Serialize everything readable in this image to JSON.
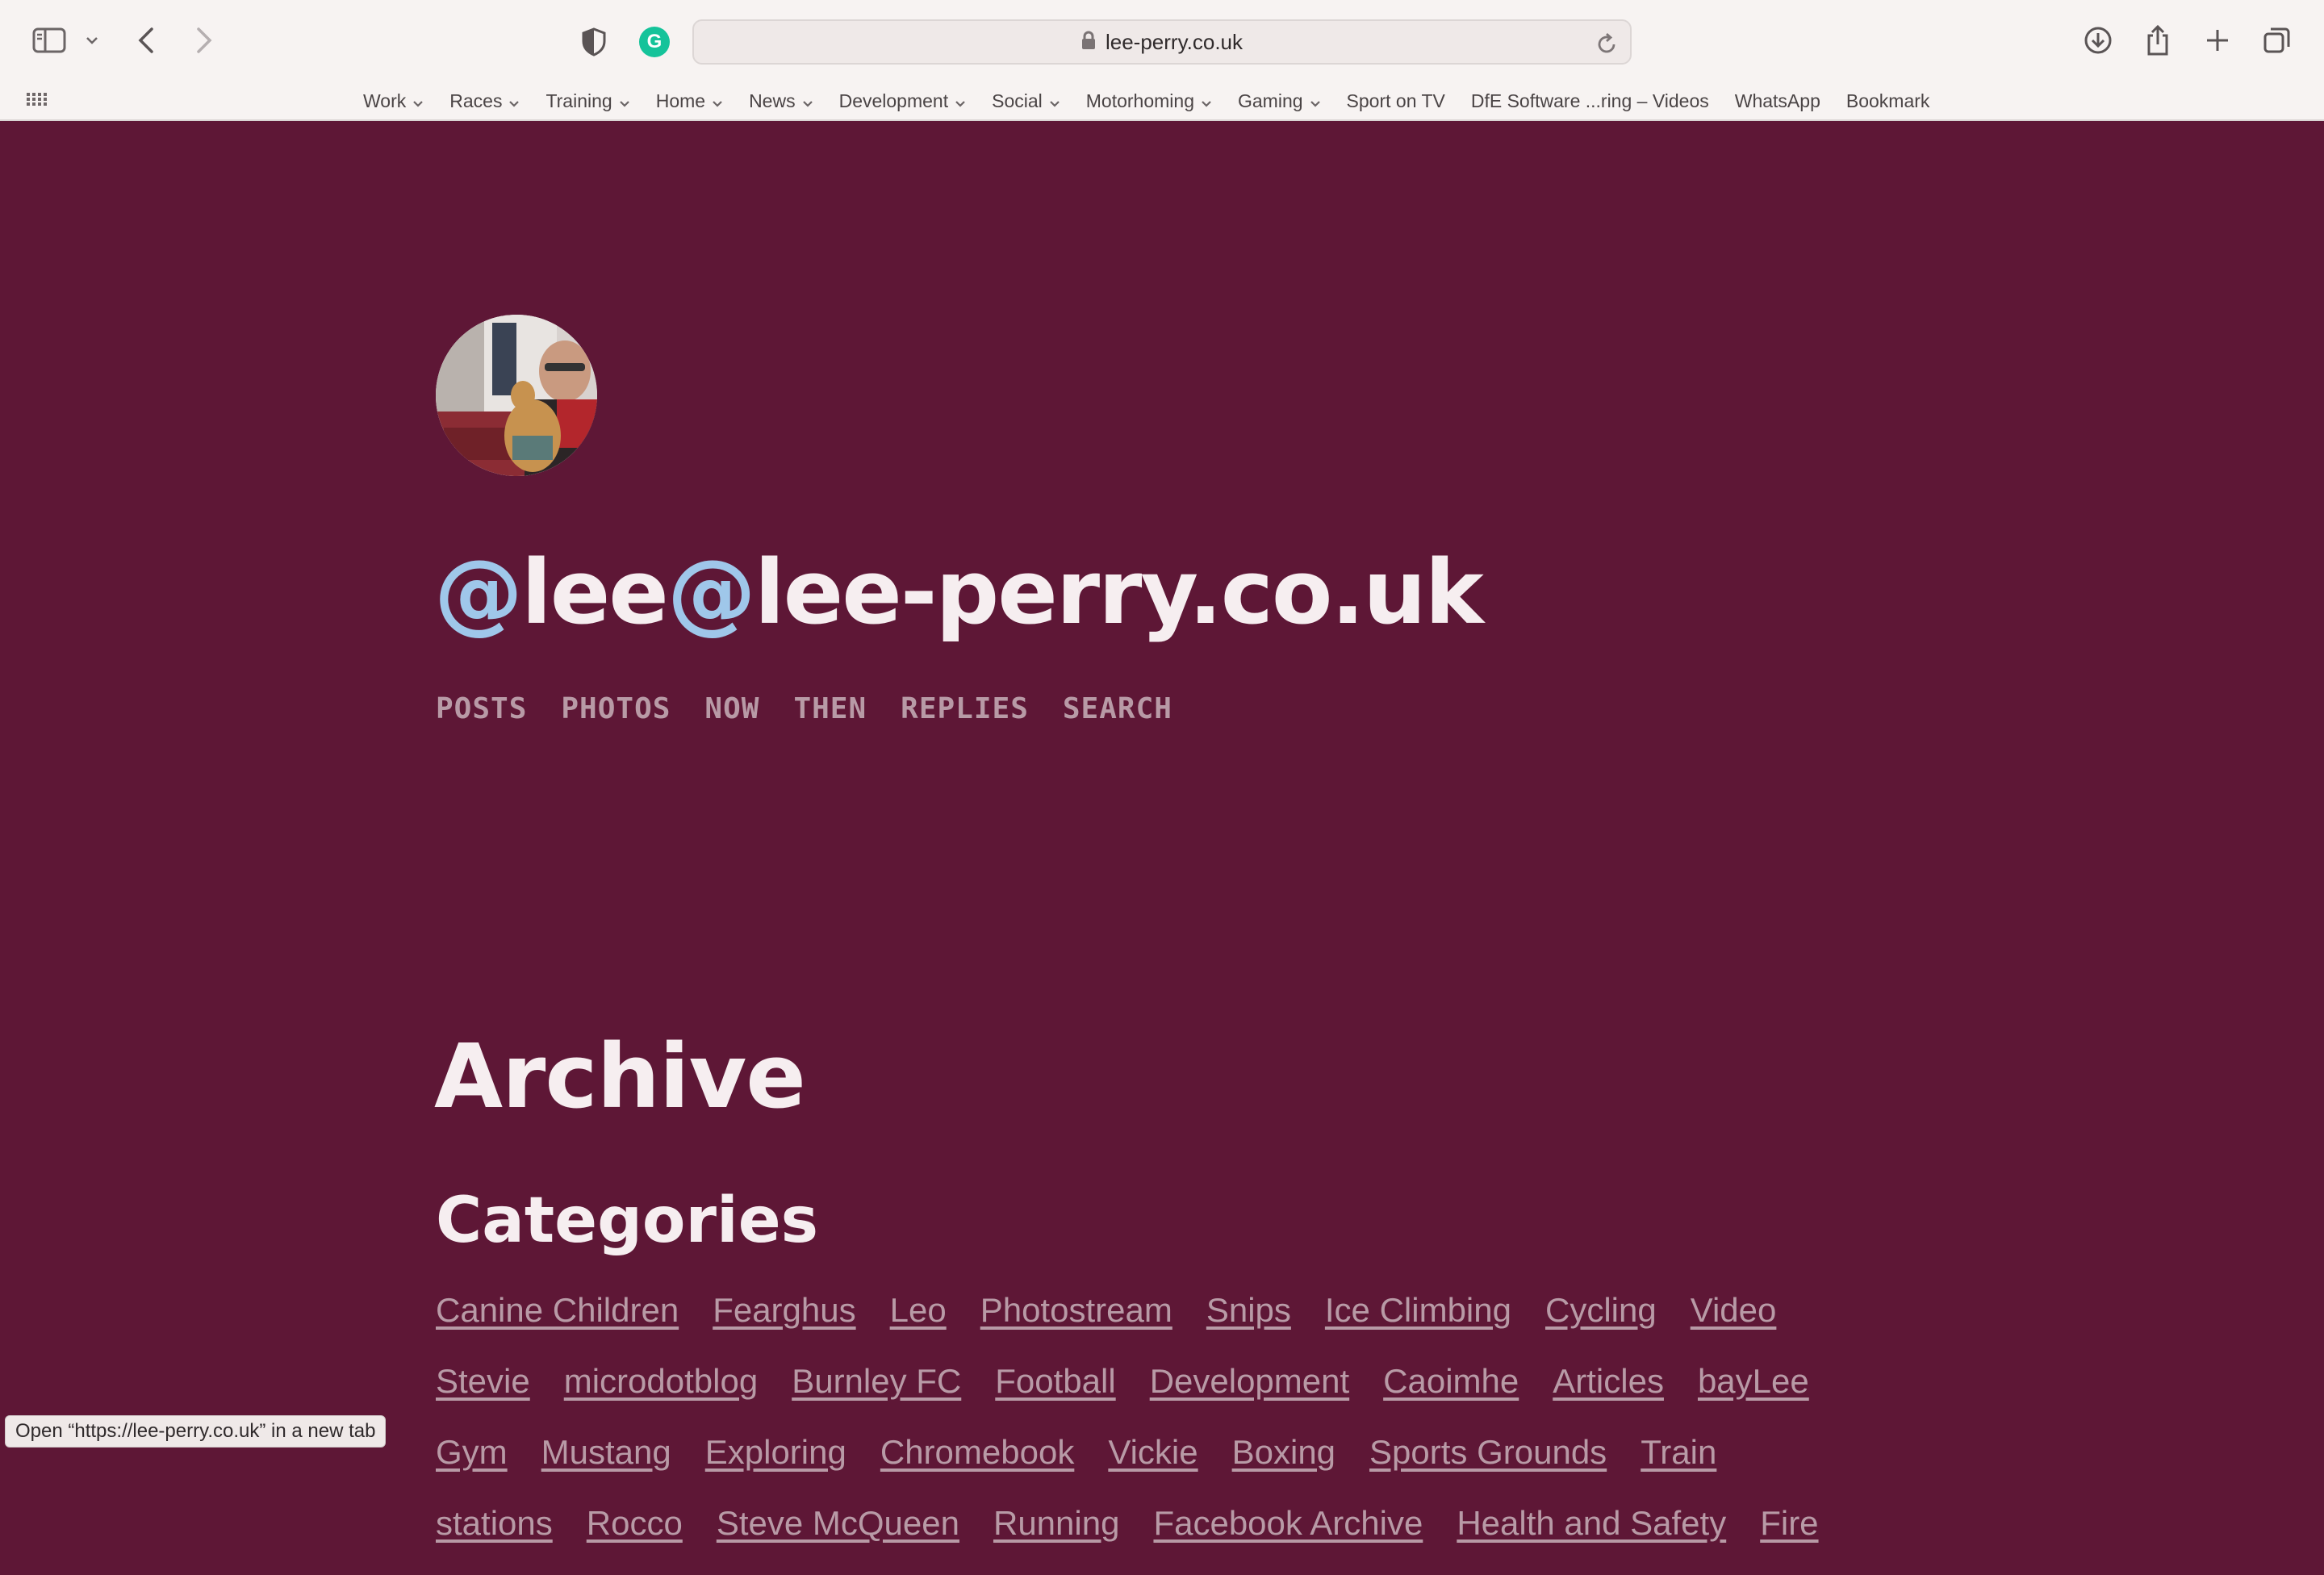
{
  "browser": {
    "url": "lee-perry.co.uk",
    "status_tip": "Open “https://lee-perry.co.uk” in a new tab",
    "bookmarks": [
      {
        "label": "Work",
        "folder": true
      },
      {
        "label": "Races",
        "folder": true
      },
      {
        "label": "Training",
        "folder": true
      },
      {
        "label": "Home",
        "folder": true
      },
      {
        "label": "News",
        "folder": true
      },
      {
        "label": "Development",
        "folder": true
      },
      {
        "label": "Social",
        "folder": true
      },
      {
        "label": "Motorhoming",
        "folder": true
      },
      {
        "label": "Gaming",
        "folder": true
      },
      {
        "label": "Sport on TV",
        "folder": false
      },
      {
        "label": "DfE Software ...ring – Videos",
        "folder": false
      },
      {
        "label": "WhatsApp",
        "folder": false
      },
      {
        "label": "Bookmark",
        "folder": false
      }
    ]
  },
  "site": {
    "title_parts": [
      "@",
      "lee",
      "@",
      "lee-perry.co.uk"
    ],
    "nav": [
      "POSTS",
      "PHOTOS",
      "NOW",
      "THEN",
      "REPLIES",
      "SEARCH"
    ],
    "archive_heading": "Archive",
    "categories_heading": "Categories",
    "category_rows": [
      [
        "Canine Children",
        "Fearghus",
        "Leo",
        "Photostream",
        "Snips",
        "Ice Climbing",
        "Cycling",
        "Video"
      ],
      [
        "Stevie",
        "microdotblog",
        "Burnley FC",
        "Football",
        "Development",
        "Caoimhe",
        "Articles",
        "bayLee"
      ],
      [
        "Gym",
        "Mustang",
        "Exploring",
        "Chromebook",
        "Vickie",
        "Boxing",
        "Sports Grounds",
        "Train"
      ],
      [
        "stations",
        "Rocco",
        "Steve McQueen",
        "Running",
        "Facebook Archive",
        "Health and Safety",
        "Fire"
      ]
    ]
  },
  "colors": {
    "page_bg": "#5e1736",
    "link": "#b89aa6",
    "title": "#f6eef0",
    "at_accent": "#9fc7ea"
  },
  "icons": [
    "sidebar-icon",
    "chevron-down-icon",
    "back-icon",
    "forward-icon",
    "privacy-shield-icon",
    "grammarly-icon",
    "lock-icon",
    "reload-icon",
    "download-icon",
    "share-icon",
    "new-tab-icon",
    "tab-overview-icon",
    "apps-grid-icon"
  ]
}
